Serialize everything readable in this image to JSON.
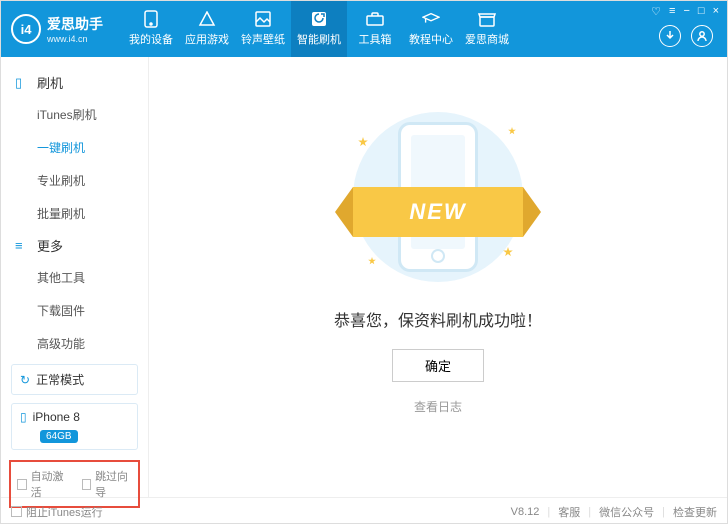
{
  "logo": {
    "icon_text": "i4",
    "title": "爱思助手",
    "subtitle": "www.i4.cn"
  },
  "nav": [
    {
      "label": "我的设备"
    },
    {
      "label": "应用游戏"
    },
    {
      "label": "铃声壁纸"
    },
    {
      "label": "智能刷机"
    },
    {
      "label": "工具箱"
    },
    {
      "label": "教程中心"
    },
    {
      "label": "爱思商城"
    }
  ],
  "sidebar": {
    "group1": "刷机",
    "items1": [
      "iTunes刷机",
      "一键刷机",
      "专业刷机",
      "批量刷机"
    ],
    "group2": "更多",
    "items2": [
      "其他工具",
      "下载固件",
      "高级功能"
    ]
  },
  "mode": "正常模式",
  "device": {
    "name": "iPhone 8",
    "storage": "64GB"
  },
  "checks": {
    "auto_activate": "自动激活",
    "skip_guide": "跳过向导"
  },
  "main": {
    "ribbon": "NEW",
    "success": "恭喜您，保资料刷机成功啦！",
    "ok": "确定",
    "log": "查看日志"
  },
  "footer": {
    "block_itunes": "阻止iTunes运行",
    "version": "V8.12",
    "support": "客服",
    "wechat": "微信公众号",
    "update": "检查更新"
  }
}
